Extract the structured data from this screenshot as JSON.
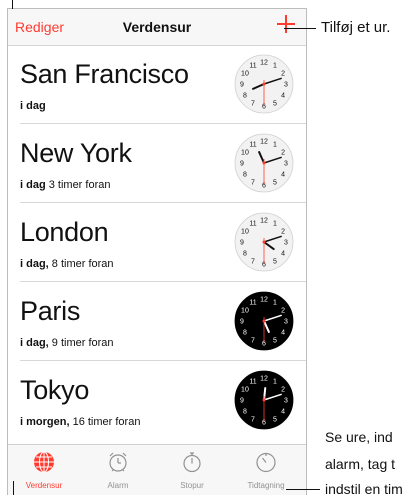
{
  "navbar": {
    "edit_label": "Rediger",
    "title": "Verdensur"
  },
  "clocks": [
    {
      "city": "San Francisco",
      "day": "i dag",
      "offset": "",
      "face": "light",
      "hour": 8,
      "minute": 12,
      "second": 30
    },
    {
      "city": "New York",
      "day": "i dag",
      "offset": " 3 timer foran",
      "face": "light",
      "hour": 11,
      "minute": 12,
      "second": 30
    },
    {
      "city": "London",
      "day": "i dag,",
      "offset": " 8 timer foran",
      "face": "light",
      "hour": 4,
      "minute": 12,
      "second": 30
    },
    {
      "city": "Paris",
      "day": "i dag,",
      "offset": " 9 timer foran",
      "face": "dark",
      "hour": 5,
      "minute": 12,
      "second": 30
    },
    {
      "city": "Tokyo",
      "day": "i morgen,",
      "offset": " 16 timer foran",
      "face": "dark",
      "hour": 12,
      "minute": 12,
      "second": 30
    }
  ],
  "tabs": [
    {
      "label": "Verdensur",
      "icon": "globe-icon",
      "active": true
    },
    {
      "label": "Alarm",
      "icon": "alarm-clock-icon",
      "active": false
    },
    {
      "label": "Stopur",
      "icon": "stopwatch-icon",
      "active": false
    },
    {
      "label": "Tidtagning",
      "icon": "timer-icon",
      "active": false
    }
  ],
  "callouts": {
    "add": "Tilføj et ur.",
    "tabs_line1": "Se ure, ind",
    "tabs_line2": "alarm, tag t",
    "tabs_line3": "indstil en tim"
  },
  "colors": {
    "accent": "#ff3b30",
    "second_hand": "#ff3b30"
  }
}
